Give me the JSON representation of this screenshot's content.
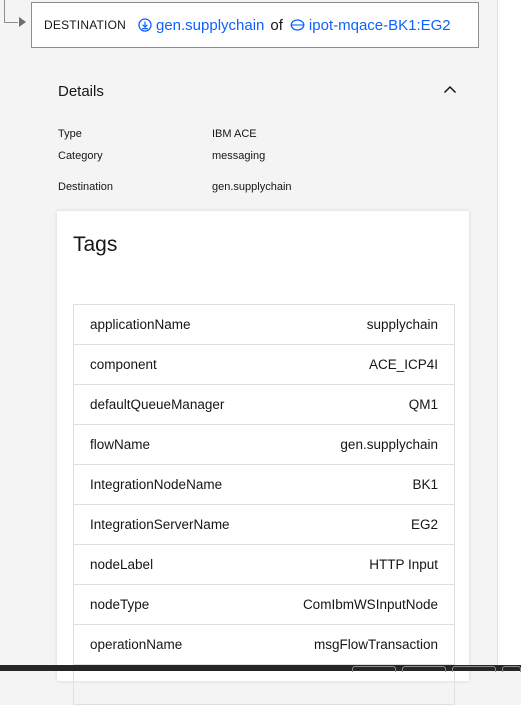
{
  "destination": {
    "kind_label": "DESTINATION",
    "flow_name": "gen.supplychain",
    "connector": "of",
    "server_name": "ipot-mqace-BK1:EG2"
  },
  "details": {
    "title": "Details",
    "properties": [
      {
        "label": "Type",
        "value": "IBM ACE"
      },
      {
        "label": "Category",
        "value": "messaging"
      },
      {
        "label": "Destination",
        "value": "gen.supplychain"
      }
    ]
  },
  "tags": {
    "title": "Tags",
    "rows": [
      {
        "key": "applicationName",
        "value": "supplychain"
      },
      {
        "key": "component",
        "value": "ACE_ICP4I"
      },
      {
        "key": "defaultQueueManager",
        "value": "QM1"
      },
      {
        "key": "flowName",
        "value": "gen.supplychain"
      },
      {
        "key": "IntegrationNodeName",
        "value": "BK1"
      },
      {
        "key": "IntegrationServerName",
        "value": "EG2"
      },
      {
        "key": "nodeLabel",
        "value": "HTTP Input"
      },
      {
        "key": "nodeType",
        "value": "ComIbmWSInputNode"
      },
      {
        "key": "operationName",
        "value": "msgFlowTransaction"
      },
      {
        "key": "",
        "value": ""
      }
    ]
  },
  "colors": {
    "link": "#0f62fe",
    "background": "#f4f4f4",
    "card": "#ffffff",
    "border": "#e0e0e0"
  },
  "icons": [
    "flow-icon",
    "server-icon",
    "chevron-up-icon",
    "tree-arrow-icon"
  ]
}
